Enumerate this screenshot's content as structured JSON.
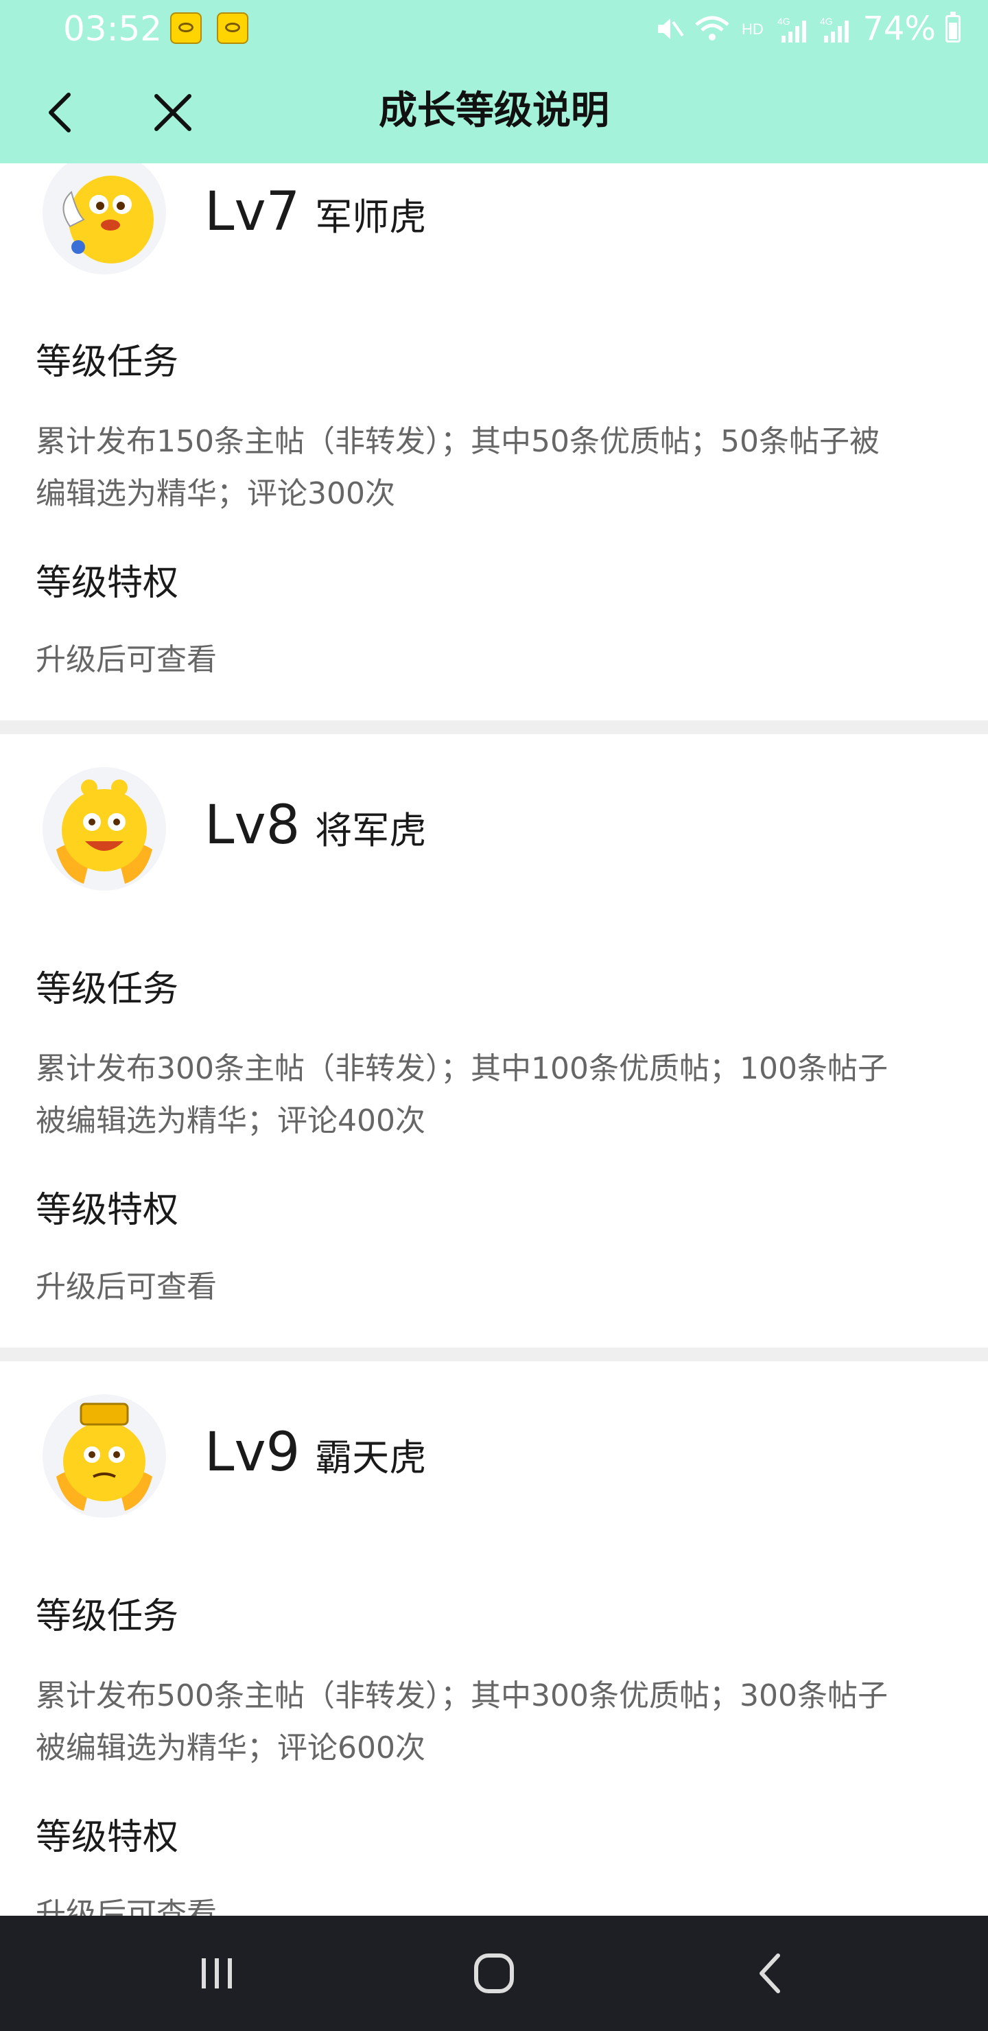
{
  "status_bar": {
    "time": "03:52",
    "battery": "74%"
  },
  "header": {
    "title": "成长等级说明"
  },
  "colors": {
    "accent": "#a3f2d9",
    "divider": "#efefef",
    "nav_bar": "#1e1f24"
  },
  "levels": [
    {
      "code": "Lv7",
      "name": "军师虎",
      "task_title": "等级任务",
      "task_line1": "累计发布150条主帖（非转发）；其中50条优质帖；50条帖子被",
      "task_line2": "编辑选为精华；评论300次",
      "privilege_title": "等级特权",
      "privilege_text": "升级后可查看"
    },
    {
      "code": "Lv8",
      "name": "将军虎",
      "task_title": "等级任务",
      "task_line1": "累计发布300条主帖（非转发）；其中100条优质帖；100条帖子",
      "task_line2": "被编辑选为精华；评论400次",
      "privilege_title": "等级特权",
      "privilege_text": "升级后可查看"
    },
    {
      "code": "Lv9",
      "name": "霸天虎",
      "task_title": "等级任务",
      "task_line1": "累计发布500条主帖（非转发）；其中300条优质帖；300条帖子",
      "task_line2": "被编辑选为精华；评论600次",
      "privilege_title": "等级特权",
      "privilege_text": "升级后可查看"
    }
  ]
}
